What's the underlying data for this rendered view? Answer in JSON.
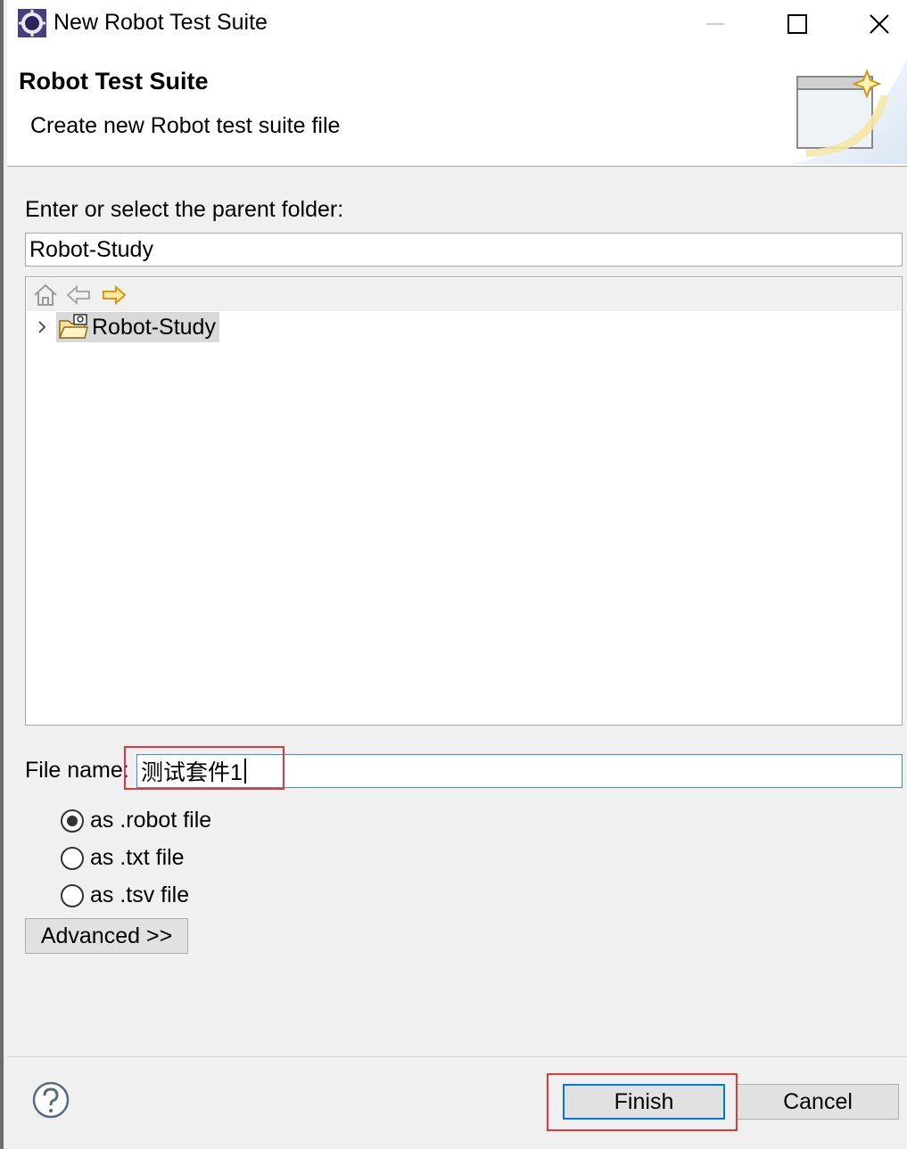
{
  "window": {
    "title": "New Robot Test Suite"
  },
  "banner": {
    "title": "Robot Test Suite",
    "description": "Create new Robot test suite file"
  },
  "folder": {
    "label": "Enter or select the parent folder:",
    "value": "Robot-Study"
  },
  "tree": {
    "toolbar": [
      "home-icon",
      "back-icon",
      "forward-icon"
    ],
    "items": [
      {
        "label": "Robot-Study",
        "icon": "project-folder-icon",
        "expanded": false,
        "selected": true
      }
    ]
  },
  "file": {
    "label": "File name:",
    "value": "测试套件1"
  },
  "format_options": [
    {
      "label": "as .robot file",
      "checked": true
    },
    {
      "label": "as .txt file",
      "checked": false
    },
    {
      "label": "as .tsv file",
      "checked": false
    }
  ],
  "buttons": {
    "advanced": "Advanced >>",
    "finish": "Finish",
    "cancel": "Cancel"
  },
  "colors": {
    "highlight": "#e0393b",
    "focus": "#0078d7"
  }
}
